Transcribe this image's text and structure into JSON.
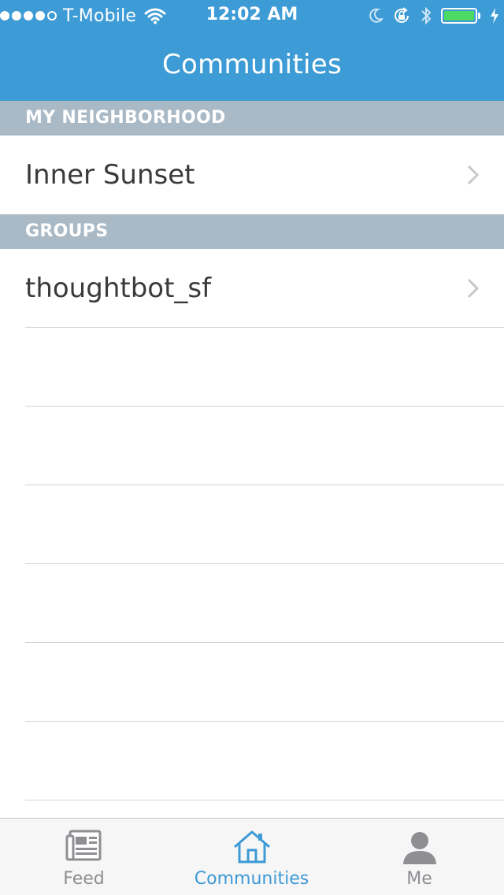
{
  "status_bar": {
    "carrier": "T-Mobile",
    "time": "12:02 AM",
    "signal_bars_filled": 4,
    "signal_bars_total": 5,
    "battery_level": 1.0,
    "icons": [
      "wifi-icon",
      "moon-icon",
      "rotation-lock-icon",
      "bluetooth-icon",
      "battery-icon",
      "charging-icon"
    ]
  },
  "nav": {
    "title": "Communities"
  },
  "sections": [
    {
      "header": "MY NEIGHBORHOOD",
      "items": [
        {
          "label": "Inner Sunset"
        }
      ]
    },
    {
      "header": "GROUPS",
      "items": [
        {
          "label": "thoughtbot_sf"
        }
      ]
    }
  ],
  "tabbar": {
    "tabs": [
      {
        "label": "Feed",
        "icon": "newspaper-icon",
        "active": false
      },
      {
        "label": "Communities",
        "icon": "house-icon",
        "active": true
      },
      {
        "label": "Me",
        "icon": "person-icon",
        "active": false
      }
    ]
  },
  "colors": {
    "header_bg": "#3d9bd6",
    "section_header_bg": "#a9b9c6",
    "active_tab": "#3d9bd6",
    "inactive_tab": "#8e8e93",
    "battery_fill": "#4cd964"
  }
}
